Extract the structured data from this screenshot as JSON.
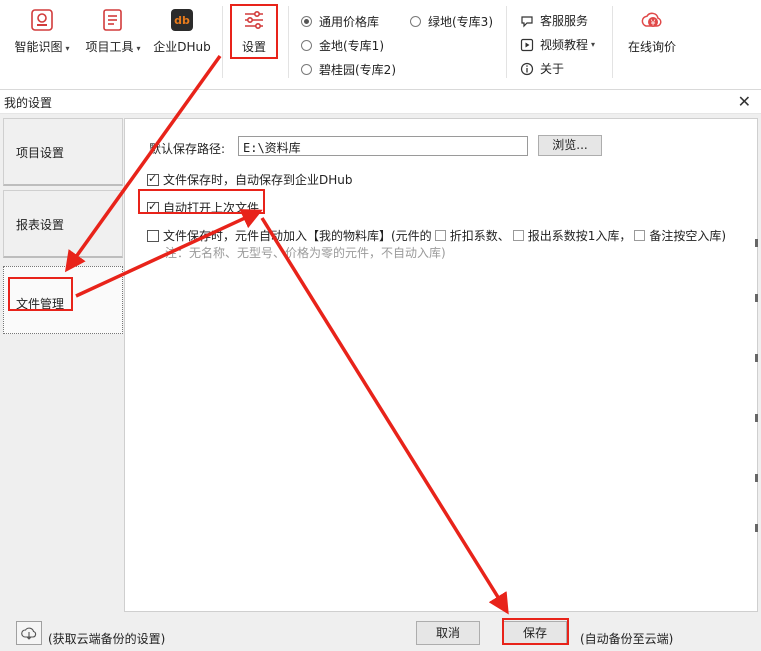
{
  "toolbar": {
    "recognize_label": "智能识图",
    "project_tools_label": "项目工具",
    "dhub_label": "企业DHub",
    "dhub_icon_text": "db",
    "settings_label": "设置",
    "libraries": [
      {
        "label": "通用价格库",
        "selected": true
      },
      {
        "label": "金地(专库1)",
        "selected": false
      },
      {
        "label": "碧桂园(专库2)",
        "selected": false
      },
      {
        "label": "绿地(专库3)",
        "selected": false
      }
    ],
    "service_label": "客服服务",
    "video_label": "视频教程",
    "about_label": "关于",
    "inquiry_label": "在线询价",
    "inquiry_icon_text": "¥",
    "caret": "▾"
  },
  "dialog": {
    "title": "我的设置",
    "close_glyph": "✕",
    "nav": [
      {
        "label": "项目设置",
        "active": false
      },
      {
        "label": "报表设置",
        "active": false
      },
      {
        "label": "文件管理",
        "active": true
      }
    ],
    "path_label": "默认保存路径:",
    "path_value": "E:\\资料库",
    "browse_label": "浏览...",
    "opt_autosave_dhub": "文件保存时，自动保存到企业DHub",
    "opt_open_last": "自动打开上次文件",
    "opt_add_library": "文件保存时，元件自动加入【我的物料库】(元件的",
    "sub_discount": "折扣系数、",
    "sub_report": "报出系数按1入库，",
    "sub_remark": "备注按空入库)",
    "note": "注：无名称、无型号、价格为零的元件，不自动入库)",
    "cloud_settings_label": "(获取云端备份的设置)",
    "cancel_label": "取消",
    "save_label": "保存",
    "backup_label": "(自动备份至云端)"
  },
  "colors": {
    "annotation": "#e8231a",
    "dhub_icon_bg": "#e87b1c",
    "inquiry_icon_bg": "#e04848"
  }
}
